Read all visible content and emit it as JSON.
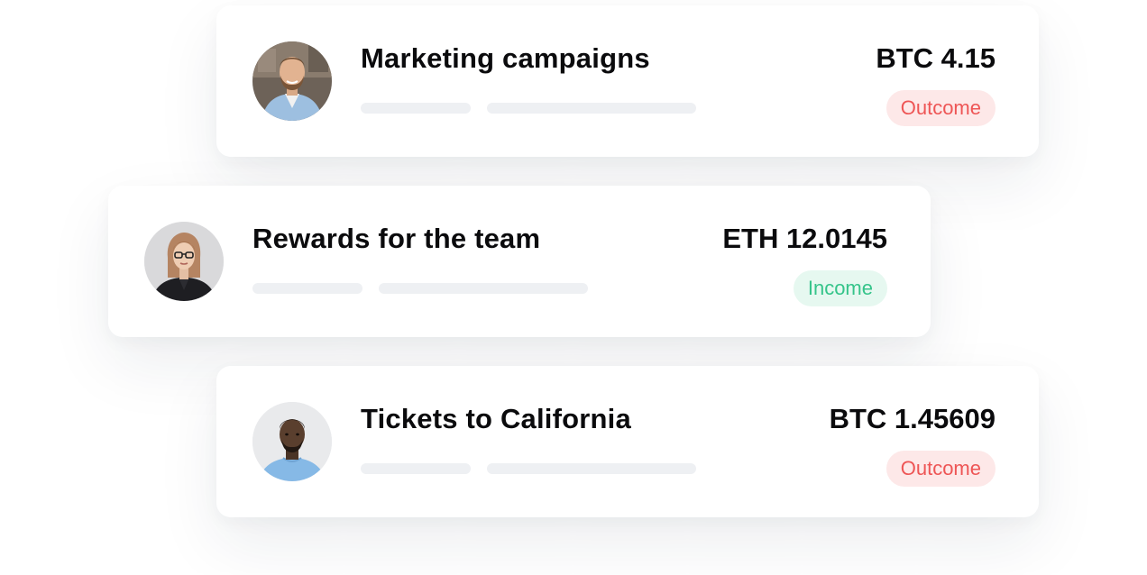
{
  "transactions": [
    {
      "title": "Marketing campaigns",
      "amount": "BTC 4.15",
      "type": "Outcome",
      "avatar": "man-with-beard-avatar"
    },
    {
      "title": "Rewards for the team",
      "amount": "ETH 12.0145",
      "type": "Income",
      "avatar": "woman-with-glasses-avatar"
    },
    {
      "title": "Tickets to California",
      "amount": "BTC 1.45609",
      "type": "Outcome",
      "avatar": "man-in-blue-shirt-avatar"
    }
  ],
  "colors": {
    "outcome_text": "#ee5555",
    "outcome_bg": "#fde8e8",
    "income_text": "#35c48a",
    "income_bg": "#e6f8f0"
  }
}
